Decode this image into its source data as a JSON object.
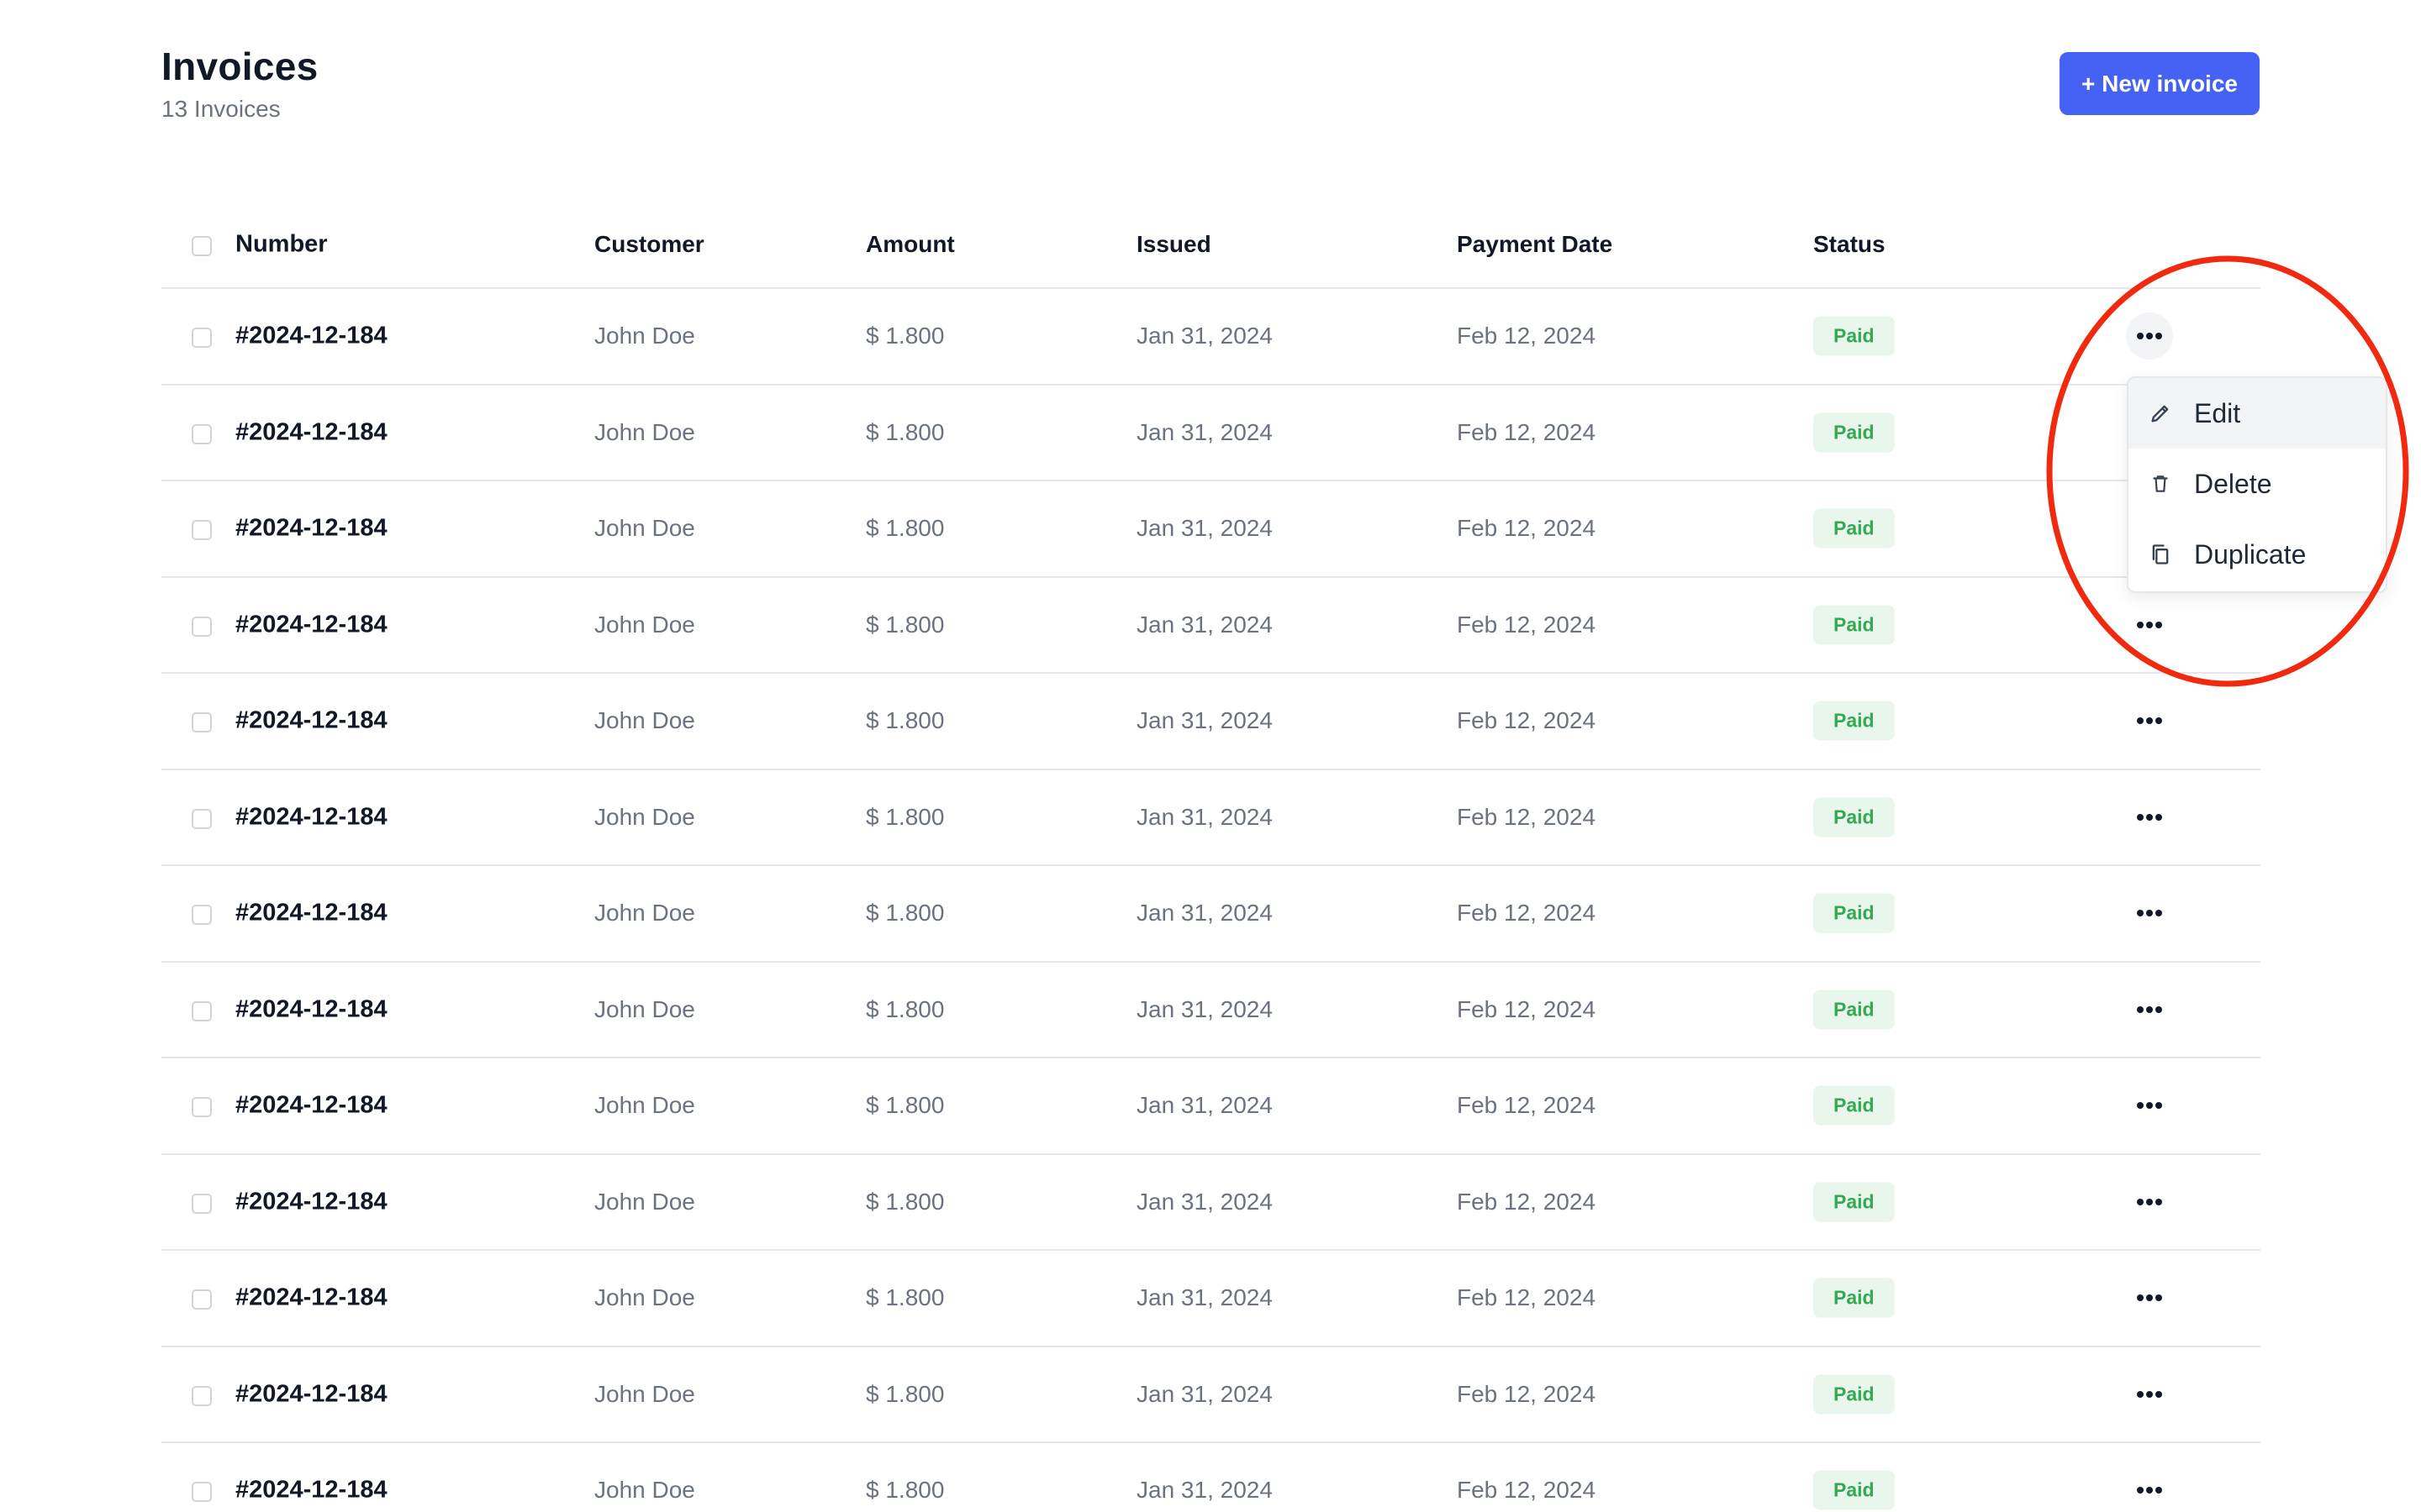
{
  "header": {
    "title": "Invoices",
    "subtitle": "13 Invoices",
    "new_button_label": "+ New invoice"
  },
  "table": {
    "columns": [
      "Number",
      "Customer",
      "Amount",
      "Issued",
      "Payment Date",
      "Status"
    ],
    "rows": [
      {
        "number": "#2024-12-184",
        "customer": "John Doe",
        "amount": "$ 1.800",
        "issued": "Jan 31, 2024",
        "payment_date": "Feb 12, 2024",
        "status": "Paid"
      },
      {
        "number": "#2024-12-184",
        "customer": "John Doe",
        "amount": "$ 1.800",
        "issued": "Jan 31, 2024",
        "payment_date": "Feb 12, 2024",
        "status": "Paid"
      },
      {
        "number": "#2024-12-184",
        "customer": "John Doe",
        "amount": "$ 1.800",
        "issued": "Jan 31, 2024",
        "payment_date": "Feb 12, 2024",
        "status": "Paid"
      },
      {
        "number": "#2024-12-184",
        "customer": "John Doe",
        "amount": "$ 1.800",
        "issued": "Jan 31, 2024",
        "payment_date": "Feb 12, 2024",
        "status": "Paid"
      },
      {
        "number": "#2024-12-184",
        "customer": "John Doe",
        "amount": "$ 1.800",
        "issued": "Jan 31, 2024",
        "payment_date": "Feb 12, 2024",
        "status": "Paid"
      },
      {
        "number": "#2024-12-184",
        "customer": "John Doe",
        "amount": "$ 1.800",
        "issued": "Jan 31, 2024",
        "payment_date": "Feb 12, 2024",
        "status": "Paid"
      },
      {
        "number": "#2024-12-184",
        "customer": "John Doe",
        "amount": "$ 1.800",
        "issued": "Jan 31, 2024",
        "payment_date": "Feb 12, 2024",
        "status": "Paid"
      },
      {
        "number": "#2024-12-184",
        "customer": "John Doe",
        "amount": "$ 1.800",
        "issued": "Jan 31, 2024",
        "payment_date": "Feb 12, 2024",
        "status": "Paid"
      },
      {
        "number": "#2024-12-184",
        "customer": "John Doe",
        "amount": "$ 1.800",
        "issued": "Jan 31, 2024",
        "payment_date": "Feb 12, 2024",
        "status": "Paid"
      },
      {
        "number": "#2024-12-184",
        "customer": "John Doe",
        "amount": "$ 1.800",
        "issued": "Jan 31, 2024",
        "payment_date": "Feb 12, 2024",
        "status": "Paid"
      },
      {
        "number": "#2024-12-184",
        "customer": "John Doe",
        "amount": "$ 1.800",
        "issued": "Jan 31, 2024",
        "payment_date": "Feb 12, 2024",
        "status": "Paid"
      },
      {
        "number": "#2024-12-184",
        "customer": "John Doe",
        "amount": "$ 1.800",
        "issued": "Jan 31, 2024",
        "payment_date": "Feb 12, 2024",
        "status": "Paid"
      },
      {
        "number": "#2024-12-184",
        "customer": "John Doe",
        "amount": "$ 1.800",
        "issued": "Jan 31, 2024",
        "payment_date": "Feb 12, 2024",
        "status": "Paid"
      }
    ],
    "open_menu_row": 0
  },
  "row_menu": {
    "items": [
      {
        "label": "Edit",
        "icon": "pencil-icon"
      },
      {
        "label": "Delete",
        "icon": "trash-icon"
      },
      {
        "label": "Duplicate",
        "icon": "copy-icon"
      }
    ]
  },
  "colors": {
    "accent": "#4562f4",
    "paid_badge_bg": "#e8f6ec",
    "paid_badge_text": "#34a853",
    "annotation": "#f0290f"
  }
}
